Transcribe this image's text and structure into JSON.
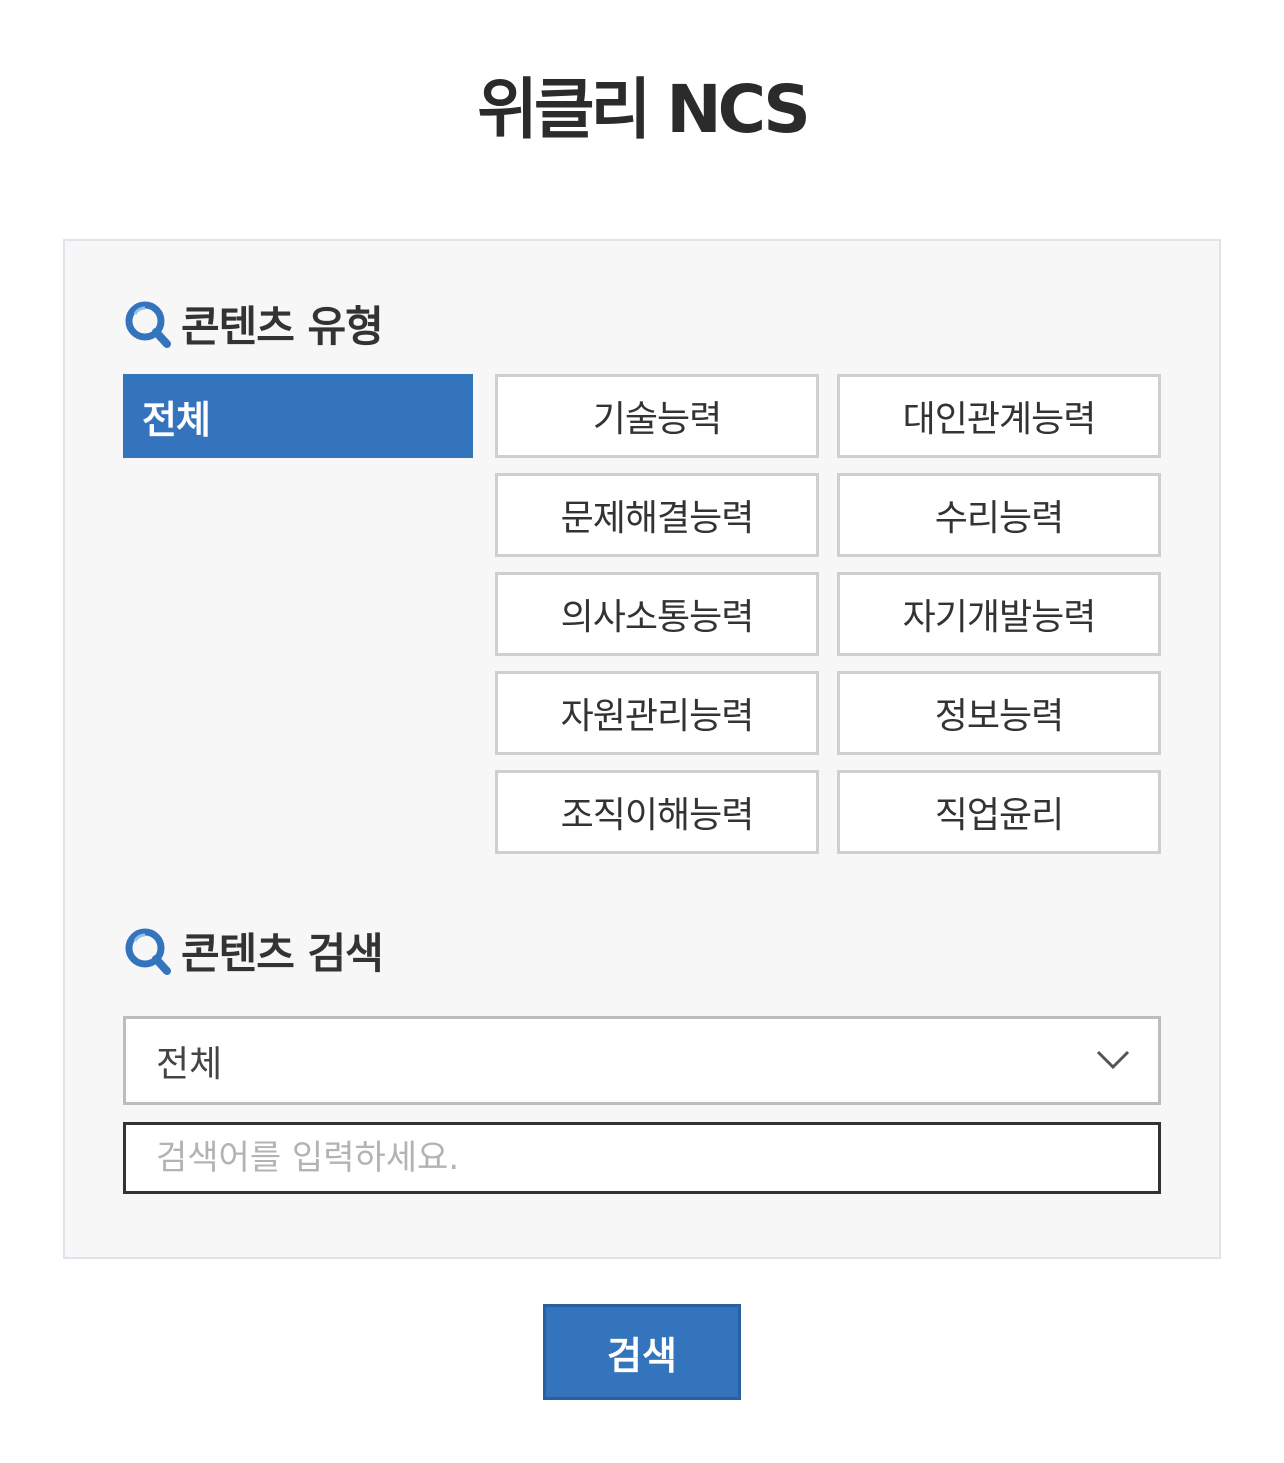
{
  "page": {
    "title": "위클리 NCS"
  },
  "content_type": {
    "heading": "콘텐츠 유형",
    "heading_icon": "search-icon",
    "selected": "전체",
    "options": [
      "기술능력",
      "대인관계능력",
      "문제해결능력",
      "수리능력",
      "의사소통능력",
      "자기개발능력",
      "자원관리능력",
      "정보능력",
      "조직이해능력",
      "직업윤리"
    ]
  },
  "content_search": {
    "heading": "콘텐츠 검색",
    "heading_icon": "search-icon",
    "select_value": "전체",
    "select_icon": "chevron-down-icon",
    "input_value": "",
    "input_placeholder": "검색어를 입력하세요."
  },
  "submit_label": "검색",
  "colors": {
    "accent": "#3474bc",
    "panel_bg": "#f7f7f7",
    "panel_border": "#dfe3ea",
    "button_border": "#cfcfcf"
  }
}
